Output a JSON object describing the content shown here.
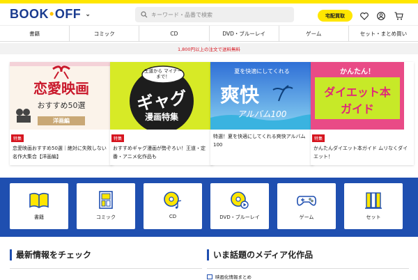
{
  "header": {
    "logo": {
      "part1": "BOOK",
      "dot": "•",
      "part2": "OFF"
    },
    "search_placeholder": "キーワード・品番で検索",
    "pickup_label": "宅配買取",
    "icons": [
      "heart-icon",
      "user-icon",
      "cart-icon"
    ]
  },
  "nav": [
    "書籍",
    "コミック",
    "CD",
    "DVD・ブルーレイ",
    "ゲーム",
    "セット・まとめ買い"
  ],
  "notice": "1,800円以上の注文で送料無料",
  "features": [
    {
      "tag": "特集",
      "title": "恋愛映画おすすめ50選｜絶対に失敗しない名作大集合【洋画編】",
      "img_main": "恋愛映画",
      "img_sub": "おすすめ50選",
      "img_badge": "洋画編"
    },
    {
      "tag": "特集",
      "title": "おすすめギャグ漫画が勢ぞろい！王道・定番・アニメ化作品も",
      "img_top": "王道から マイナーまで！",
      "img_main": "ギャグ",
      "img_sub": "漫画特集"
    },
    {
      "tag": "",
      "title": "特選！夏を快適にしてくれる爽快アルバム100",
      "img_top": "夏を快適にしてくれる",
      "img_main": "爽快",
      "img_sub": "アルバム100"
    },
    {
      "tag": "特集",
      "title": "かんたんダイエット本ガイド ムリなくダイエット！",
      "img_top": "かんたん！",
      "img_main": "ダイエット本",
      "img_sub": "ガイド"
    }
  ],
  "categories": [
    {
      "label": "書籍",
      "icon": "book-icon"
    },
    {
      "label": "コミック",
      "icon": "comic-icon"
    },
    {
      "label": "CD",
      "icon": "cd-icon"
    },
    {
      "label": "DVD・ブルーレイ",
      "icon": "dvd-icon"
    },
    {
      "label": "ゲーム",
      "icon": "gamepad-icon"
    },
    {
      "label": "セット",
      "icon": "book-set-icon"
    }
  ],
  "sections": {
    "latest": "最新情報をチェック",
    "media": "いま話題のメディア化作品",
    "media_item": "映画化情報まとめ"
  },
  "colors": {
    "brand_blue": "#1f4fb0",
    "accent_yellow": "#ffe600",
    "red": "#d6141e"
  }
}
